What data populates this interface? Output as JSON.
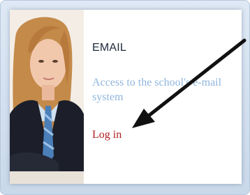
{
  "card": {
    "title": "EMAIL",
    "description": "Access to the school's e-mail system",
    "link_label": "Log in"
  },
  "colors": {
    "title": "#1e2a3a",
    "description": "#8fb5dc",
    "link": "#b11d1d",
    "arrow": "#111111"
  },
  "icons": {
    "pointer": "arrow-pointer-icon",
    "photo": "student-photo"
  }
}
